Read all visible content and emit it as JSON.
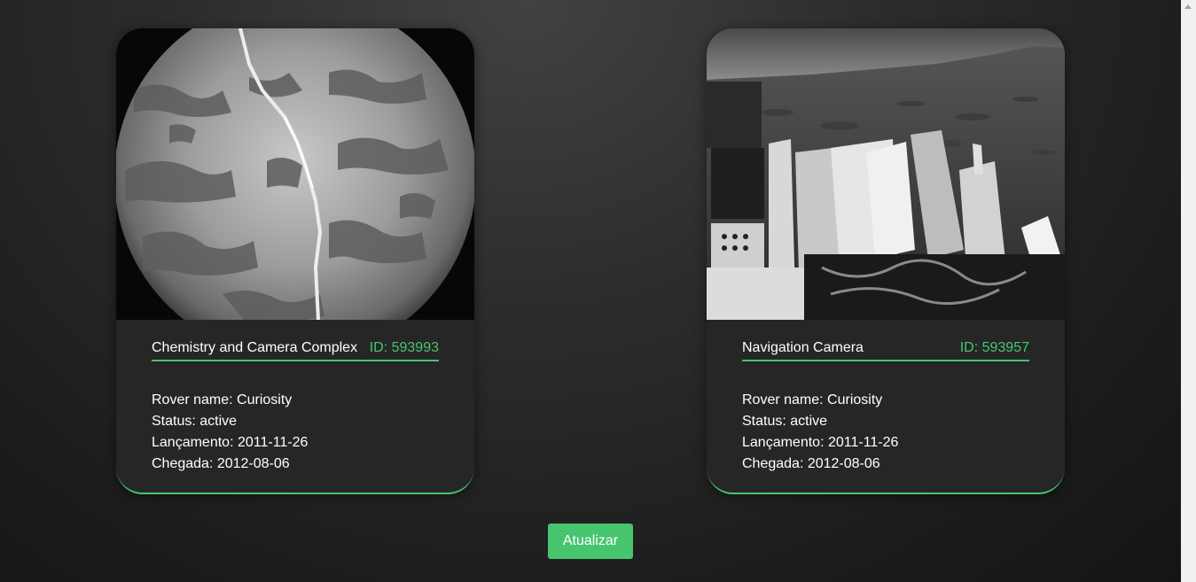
{
  "cards": [
    {
      "camera_name": "Chemistry and Camera Complex",
      "id_text": "ID: 593993",
      "rover_name": "Rover name: Curiosity",
      "status": "Status: active",
      "launch": "Lançamento: 2011-11-26",
      "landing": "Chegada: 2012-08-06",
      "image_alt": "Grayscale circular microscopic image of rock surface with a white vein"
    },
    {
      "camera_name": "Navigation Camera",
      "id_text": "ID: 593957",
      "rover_name": "Rover name: Curiosity",
      "status": "Status: active",
      "launch": "Lançamento: 2011-11-26",
      "landing": "Chegada: 2012-08-06",
      "image_alt": "Grayscale image of rover deck with Martian terrain in background"
    }
  ],
  "refresh_button": "Atualizar",
  "colors": {
    "accent": "#47c56e",
    "card_bg": "#262626",
    "page_bg": "#1c1c1c"
  }
}
